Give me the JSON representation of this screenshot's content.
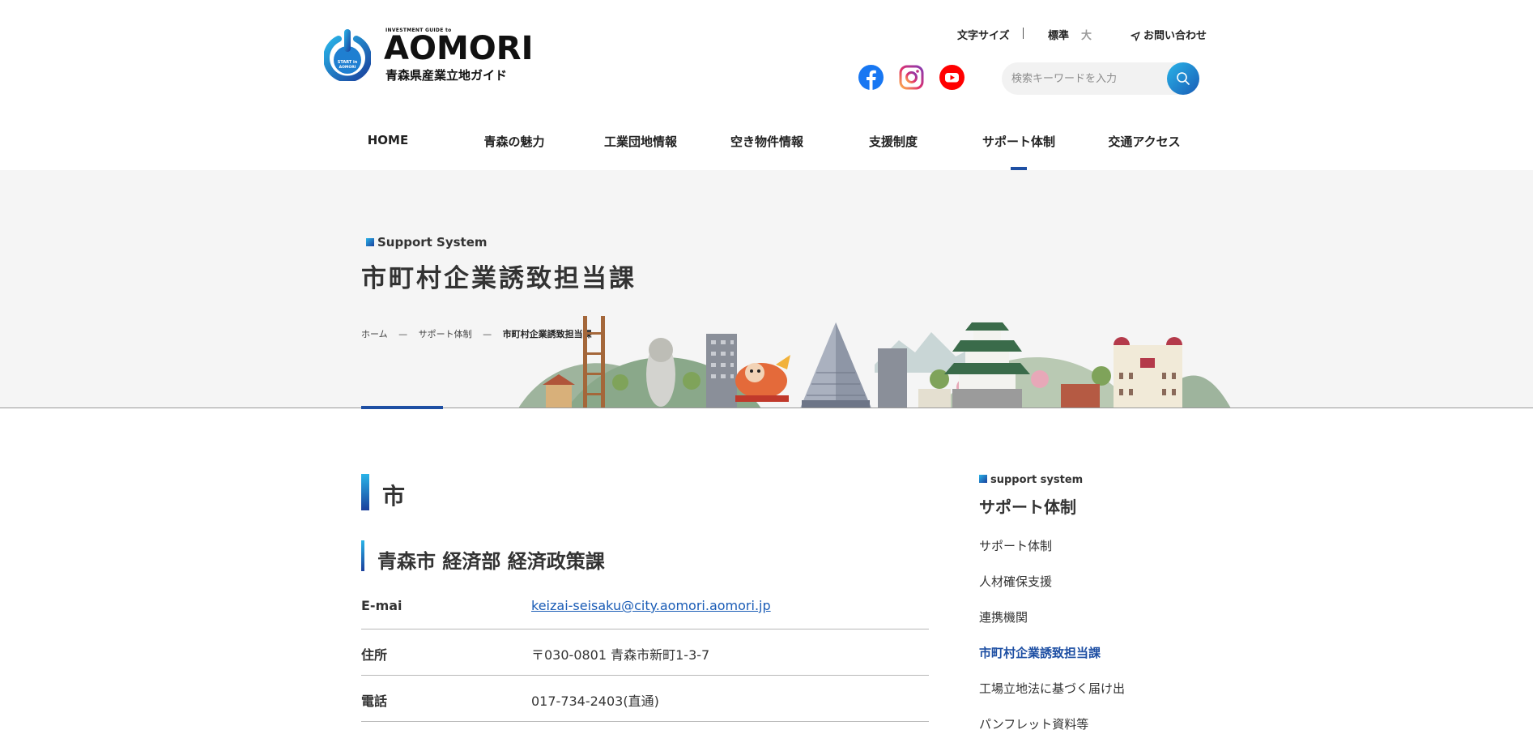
{
  "brand": {
    "small": "INVESTMENT GUIDE to",
    "name": "AOMORI",
    "subtitle": "青森県産業立地ガイド",
    "mark_text_1": "START in",
    "mark_text_2": "AOMORI"
  },
  "utility": {
    "font_size_label": "文字サイズ",
    "size_normal": "標準",
    "size_large": "大",
    "contact": "お問い合わせ"
  },
  "social": {
    "facebook": "facebook-icon",
    "instagram": "instagram-icon",
    "youtube": "youtube-icon"
  },
  "search": {
    "placeholder": "検索キーワードを入力"
  },
  "nav": {
    "items": [
      "HOME",
      "青森の魅力",
      "工業団地情報",
      "空き物件情報",
      "支援制度",
      "サポート体制",
      "交通アクセス"
    ],
    "active": "サポート体制"
  },
  "hero": {
    "label": "Support System",
    "title": "市町村企業誘致担当課",
    "breadcrumb": [
      "ホーム",
      "—",
      "サポート体制",
      "—",
      "市町村企業誘致担当課"
    ]
  },
  "main": {
    "heading": "市",
    "subheading": "青森市 経済部 経済政策課",
    "rows": [
      {
        "label": "E-mai",
        "value": "keizai-seisaku@city.aomori.aomori.jp"
      },
      {
        "label": "住所",
        "value": "〒030-0801 青森市新町1-3-7"
      },
      {
        "label": "電話",
        "value": "017-734-2403(直通)"
      }
    ]
  },
  "sidebar": {
    "label": "support system",
    "title": "サポート体制",
    "items": [
      "サポート体制",
      "人材確保支援",
      "連携機関",
      "市町村企業誘致担当課",
      "工場立地法に基づく届け出",
      "パンフレット資料等"
    ],
    "active": "市町村企業誘致担当課"
  },
  "colors": {
    "accent": "#1e4fa3",
    "link": "#1a5cb6",
    "hero_bg": "#f5f5f5",
    "facebook": "#1877f2",
    "youtube": "#ff0000"
  }
}
